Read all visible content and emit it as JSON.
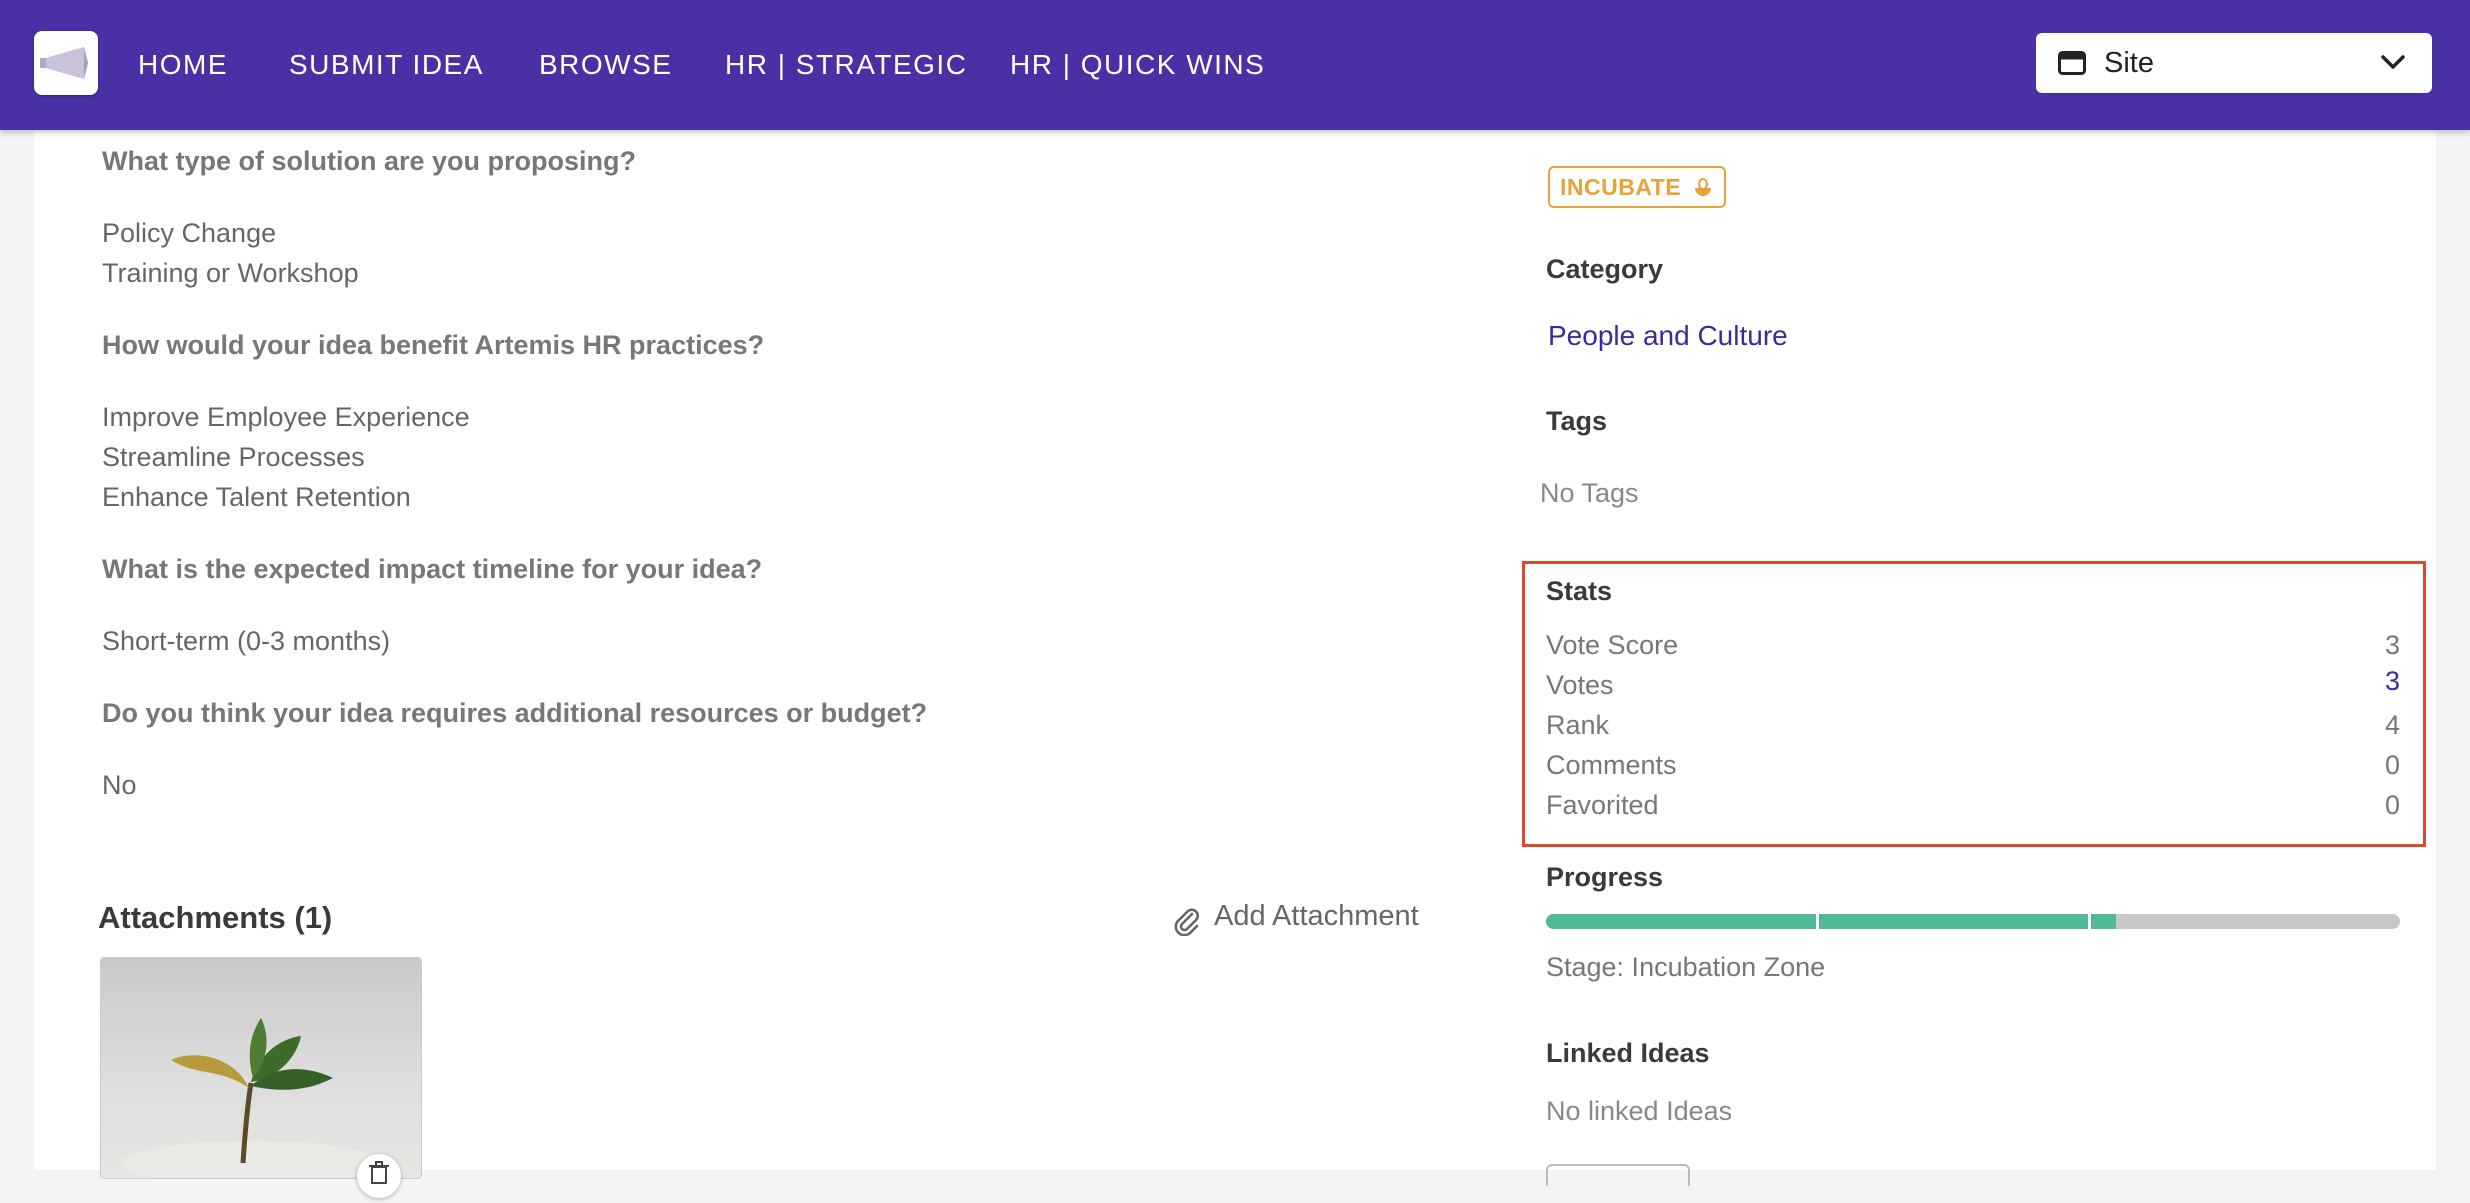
{
  "nav": {
    "items": [
      "HOME",
      "SUBMIT IDEA",
      "BROWSE",
      "HR | STRATEGIC",
      "HR | QUICK WINS"
    ],
    "site_select": {
      "label": "Site"
    }
  },
  "questions": [
    {
      "question": "What type of solution are you proposing?",
      "answers": [
        "Policy Change",
        "Training or Workshop"
      ]
    },
    {
      "question": "How would your idea benefit Artemis HR practices?",
      "answers": [
        "Improve Employee Experience",
        "Streamline Processes",
        "Enhance Talent Retention"
      ]
    },
    {
      "question": "What is the expected impact timeline for your idea?",
      "answers": [
        "Short-term (0-3 months)"
      ]
    },
    {
      "question": "Do you think your idea requires additional resources or budget?",
      "answers": [
        "No"
      ]
    }
  ],
  "attachments": {
    "title": "Attachments (1)",
    "add_label": "Add Attachment"
  },
  "sidebar": {
    "status_badge": "INCUBATE",
    "category": {
      "heading": "Category",
      "value": "People and Culture"
    },
    "tags": {
      "heading": "Tags",
      "empty": "No Tags"
    },
    "stats": {
      "heading": "Stats",
      "rows": [
        {
          "label": "Vote Score",
          "value": "3"
        },
        {
          "label": "Votes",
          "value": "3"
        },
        {
          "label": "Rank",
          "value": "4"
        },
        {
          "label": "Comments",
          "value": "0"
        },
        {
          "label": "Favorited",
          "value": "0"
        }
      ]
    },
    "progress": {
      "heading": "Progress",
      "stage": "Stage: Incubation Zone",
      "completed_fraction": 0.667
    },
    "linked_ideas": {
      "heading": "Linked Ideas",
      "empty": "No linked Ideas"
    }
  },
  "colors": {
    "header": "#4b30a5",
    "badge": "#e8a23a",
    "link": "#3a2aa0",
    "progress_fill": "#52b898",
    "highlight_box": "#e04a2a"
  }
}
